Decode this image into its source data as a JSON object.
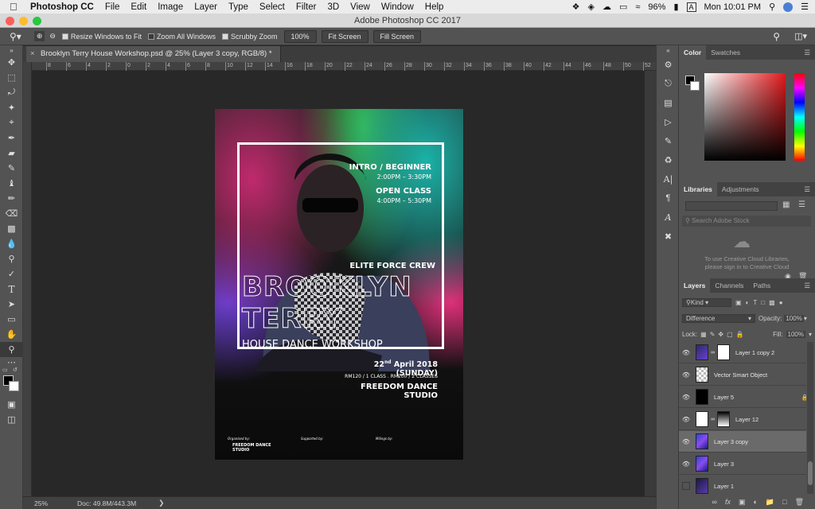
{
  "menubar": {
    "app_name": "Photoshop CC",
    "items": [
      "File",
      "Edit",
      "Image",
      "Layer",
      "Type",
      "Select",
      "Filter",
      "3D",
      "View",
      "Window",
      "Help"
    ],
    "battery": "96%",
    "input_source": "A",
    "clock": "Mon 10:01 PM"
  },
  "window": {
    "title": "Adobe Photoshop CC 2017"
  },
  "options": {
    "resize_windows": "Resize Windows to Fit",
    "zoom_all_windows": "Zoom All Windows",
    "scrubby_zoom": "Scrubby Zoom",
    "zoom_value": "100%",
    "fit_screen": "Fit Screen",
    "fill_screen": "Fill Screen"
  },
  "document": {
    "tab_title": "Brooklyn Terry House Workshop.psd @ 25% (Layer 3 copy, RGB/8) *",
    "zoom": "25%",
    "doc_info": "Doc: 49.8M/443.3M"
  },
  "ruler": {
    "labels": [
      "8",
      "6",
      "4",
      "2",
      "0",
      "2",
      "4",
      "6",
      "8",
      "10",
      "12",
      "14",
      "16",
      "18",
      "20",
      "22",
      "24",
      "26",
      "28",
      "30",
      "32",
      "34",
      "36",
      "38",
      "40",
      "42",
      "44",
      "46",
      "48",
      "50",
      "52",
      "54",
      "56",
      "58",
      "60",
      "62"
    ]
  },
  "poster": {
    "line1": "INTRO / BEGINNER",
    "line2": "2:00PM – 3:30PM",
    "line3": "OPEN CLASS",
    "line4": "4:00PM – 5:30PM",
    "crew": "ELITE FORCE CREW",
    "title1": "BROOKLYN",
    "title2": "TERRY",
    "subtitle": "HOUSE DANCE WORKSHOP",
    "date_day": "22",
    "date_sup": "nd",
    "date_rest": " April 2018 (SUNDAY)",
    "price": "RM120 / 1 CLASS . RM200 / 2 CLASSES",
    "studio": "FREEDOM DANCE STUDIO",
    "organized_by": "Organised by:",
    "supported_by": "Supported by:",
    "media_by": "Milings by:",
    "org_logo": "FREEDOM DANCE STUDIO"
  },
  "color_panel": {
    "tab_active": "Color",
    "tab_other": "Swatches"
  },
  "libraries_panel": {
    "tab_active": "Libraries",
    "tab_other": "Adjustments",
    "search_placeholder": "Search Adobe Stock",
    "message_line1": "To use Creative Cloud Libraries,",
    "message_line2": "please sign in to Creative Cloud"
  },
  "layers_panel": {
    "tab_active": "Layers",
    "tab_channels": "Channels",
    "tab_paths": "Paths",
    "filter_kind": "Kind",
    "blend_mode": "Difference",
    "opacity_label": "Opacity:",
    "opacity_value": "100%",
    "lock_label": "Lock:",
    "fill_label": "Fill:",
    "fill_value": "100%",
    "layers": [
      {
        "name": "Layer 1 copy 2",
        "selected": false
      },
      {
        "name": "Vector Smart Object",
        "selected": false
      },
      {
        "name": "Layer 5",
        "selected": false
      },
      {
        "name": "Layer 12",
        "selected": false
      },
      {
        "name": "Layer 3 copy",
        "selected": true
      },
      {
        "name": "Layer 3",
        "selected": false
      },
      {
        "name": "Layer 1",
        "selected": false
      }
    ]
  }
}
